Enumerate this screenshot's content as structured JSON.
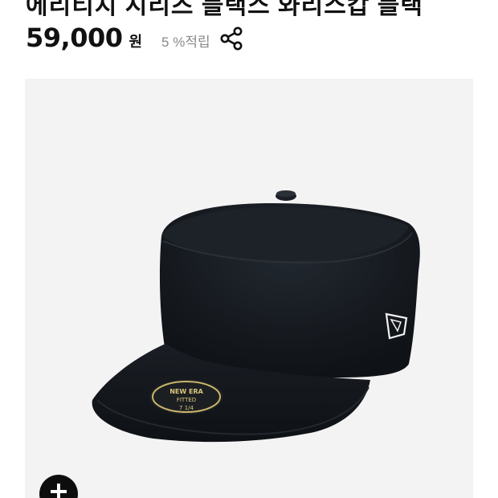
{
  "product": {
    "title_partial": "에리티지 시리즈 블랙스 와리스캅 블랙",
    "price": "59,000",
    "currency": "원",
    "points": "5 %적립"
  },
  "icons": {
    "share": "share-icon",
    "zoom": "plus-icon"
  },
  "image": {
    "badge_brand": "NEW ERA",
    "badge_fit": "FITTED",
    "badge_size": "7 1/4"
  },
  "colors": {
    "panel_bg": "#f3f3f3",
    "cap": "#14181c",
    "button": "#0d0d0d"
  }
}
